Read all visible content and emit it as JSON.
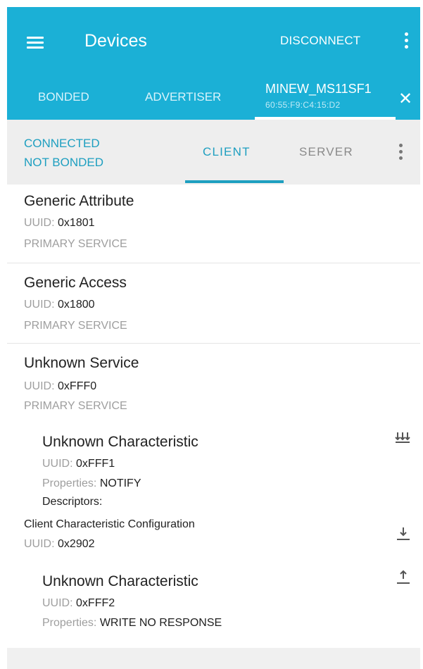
{
  "app_bar": {
    "title": "Devices",
    "disconnect_label": "DISCONNECT",
    "icons": [
      "hamburger-menu-icon",
      "more-vert-icon"
    ]
  },
  "tabs": {
    "bonded": "BONDED",
    "advertiser": "ADVERTISER",
    "device_name": "MINEW_MS11SF1",
    "device_mac": "60:55:F9:C4:15:D2",
    "close": "✕"
  },
  "sub_bar": {
    "status_line1": "CONNECTED",
    "status_line2": "NOT BONDED",
    "client": "CLIENT",
    "server": "SERVER"
  },
  "services": [
    {
      "name": "Generic Attribute",
      "uuid_label": "UUID:",
      "uuid": "0x1801",
      "type": "PRIMARY SERVICE"
    },
    {
      "name": "Generic Access",
      "uuid_label": "UUID:",
      "uuid": "0x1800",
      "type": "PRIMARY SERVICE"
    },
    {
      "name": "Unknown Service",
      "uuid_label": "UUID:",
      "uuid": "0xFFF0",
      "type": "PRIMARY SERVICE"
    }
  ],
  "characteristics": [
    {
      "name": "Unknown Characteristic",
      "uuid_label": "UUID:",
      "uuid": "0xFFF1",
      "props_label": "Properties:",
      "props": "NOTIFY",
      "descriptors_label": "Descriptors:",
      "descriptor_name": "Client Characteristic Configuration",
      "descriptor_uuid_label": "UUID:",
      "descriptor_uuid": "0x2902",
      "icon": "notify-multiple-icon",
      "descriptor_icon": "read-download-icon"
    },
    {
      "name": "Unknown Characteristic",
      "uuid_label": "UUID:",
      "uuid": "0xFFF2",
      "props_label": "Properties:",
      "props": "WRITE NO RESPONSE",
      "icon": "write-upload-icon"
    }
  ],
  "colors": {
    "accent": "#1bb0d6",
    "accent_text": "#1e9fc0"
  }
}
